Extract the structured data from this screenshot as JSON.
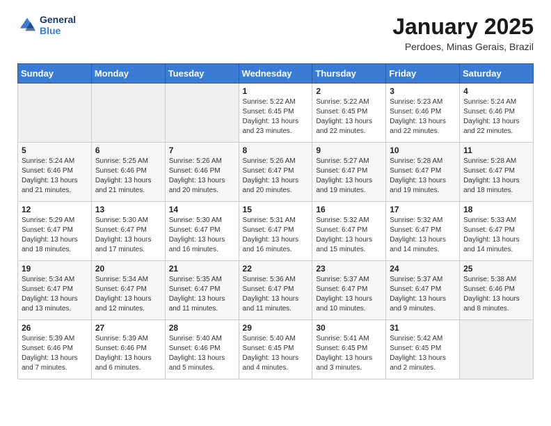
{
  "logo": {
    "line1": "General",
    "line2": "Blue"
  },
  "title": "January 2025",
  "subtitle": "Perdoes, Minas Gerais, Brazil",
  "headers": [
    "Sunday",
    "Monday",
    "Tuesday",
    "Wednesday",
    "Thursday",
    "Friday",
    "Saturday"
  ],
  "weeks": [
    [
      {
        "day": "",
        "info": ""
      },
      {
        "day": "",
        "info": ""
      },
      {
        "day": "",
        "info": ""
      },
      {
        "day": "1",
        "info": "Sunrise: 5:22 AM\nSunset: 6:45 PM\nDaylight: 13 hours\nand 23 minutes."
      },
      {
        "day": "2",
        "info": "Sunrise: 5:22 AM\nSunset: 6:45 PM\nDaylight: 13 hours\nand 22 minutes."
      },
      {
        "day": "3",
        "info": "Sunrise: 5:23 AM\nSunset: 6:46 PM\nDaylight: 13 hours\nand 22 minutes."
      },
      {
        "day": "4",
        "info": "Sunrise: 5:24 AM\nSunset: 6:46 PM\nDaylight: 13 hours\nand 22 minutes."
      }
    ],
    [
      {
        "day": "5",
        "info": "Sunrise: 5:24 AM\nSunset: 6:46 PM\nDaylight: 13 hours\nand 21 minutes."
      },
      {
        "day": "6",
        "info": "Sunrise: 5:25 AM\nSunset: 6:46 PM\nDaylight: 13 hours\nand 21 minutes."
      },
      {
        "day": "7",
        "info": "Sunrise: 5:26 AM\nSunset: 6:46 PM\nDaylight: 13 hours\nand 20 minutes."
      },
      {
        "day": "8",
        "info": "Sunrise: 5:26 AM\nSunset: 6:47 PM\nDaylight: 13 hours\nand 20 minutes."
      },
      {
        "day": "9",
        "info": "Sunrise: 5:27 AM\nSunset: 6:47 PM\nDaylight: 13 hours\nand 19 minutes."
      },
      {
        "day": "10",
        "info": "Sunrise: 5:28 AM\nSunset: 6:47 PM\nDaylight: 13 hours\nand 19 minutes."
      },
      {
        "day": "11",
        "info": "Sunrise: 5:28 AM\nSunset: 6:47 PM\nDaylight: 13 hours\nand 18 minutes."
      }
    ],
    [
      {
        "day": "12",
        "info": "Sunrise: 5:29 AM\nSunset: 6:47 PM\nDaylight: 13 hours\nand 18 minutes."
      },
      {
        "day": "13",
        "info": "Sunrise: 5:30 AM\nSunset: 6:47 PM\nDaylight: 13 hours\nand 17 minutes."
      },
      {
        "day": "14",
        "info": "Sunrise: 5:30 AM\nSunset: 6:47 PM\nDaylight: 13 hours\nand 16 minutes."
      },
      {
        "day": "15",
        "info": "Sunrise: 5:31 AM\nSunset: 6:47 PM\nDaylight: 13 hours\nand 16 minutes."
      },
      {
        "day": "16",
        "info": "Sunrise: 5:32 AM\nSunset: 6:47 PM\nDaylight: 13 hours\nand 15 minutes."
      },
      {
        "day": "17",
        "info": "Sunrise: 5:32 AM\nSunset: 6:47 PM\nDaylight: 13 hours\nand 14 minutes."
      },
      {
        "day": "18",
        "info": "Sunrise: 5:33 AM\nSunset: 6:47 PM\nDaylight: 13 hours\nand 14 minutes."
      }
    ],
    [
      {
        "day": "19",
        "info": "Sunrise: 5:34 AM\nSunset: 6:47 PM\nDaylight: 13 hours\nand 13 minutes."
      },
      {
        "day": "20",
        "info": "Sunrise: 5:34 AM\nSunset: 6:47 PM\nDaylight: 13 hours\nand 12 minutes."
      },
      {
        "day": "21",
        "info": "Sunrise: 5:35 AM\nSunset: 6:47 PM\nDaylight: 13 hours\nand 11 minutes."
      },
      {
        "day": "22",
        "info": "Sunrise: 5:36 AM\nSunset: 6:47 PM\nDaylight: 13 hours\nand 11 minutes."
      },
      {
        "day": "23",
        "info": "Sunrise: 5:37 AM\nSunset: 6:47 PM\nDaylight: 13 hours\nand 10 minutes."
      },
      {
        "day": "24",
        "info": "Sunrise: 5:37 AM\nSunset: 6:47 PM\nDaylight: 13 hours\nand 9 minutes."
      },
      {
        "day": "25",
        "info": "Sunrise: 5:38 AM\nSunset: 6:46 PM\nDaylight: 13 hours\nand 8 minutes."
      }
    ],
    [
      {
        "day": "26",
        "info": "Sunrise: 5:39 AM\nSunset: 6:46 PM\nDaylight: 13 hours\nand 7 minutes."
      },
      {
        "day": "27",
        "info": "Sunrise: 5:39 AM\nSunset: 6:46 PM\nDaylight: 13 hours\nand 6 minutes."
      },
      {
        "day": "28",
        "info": "Sunrise: 5:40 AM\nSunset: 6:46 PM\nDaylight: 13 hours\nand 5 minutes."
      },
      {
        "day": "29",
        "info": "Sunrise: 5:40 AM\nSunset: 6:45 PM\nDaylight: 13 hours\nand 4 minutes."
      },
      {
        "day": "30",
        "info": "Sunrise: 5:41 AM\nSunset: 6:45 PM\nDaylight: 13 hours\nand 3 minutes."
      },
      {
        "day": "31",
        "info": "Sunrise: 5:42 AM\nSunset: 6:45 PM\nDaylight: 13 hours\nand 2 minutes."
      },
      {
        "day": "",
        "info": ""
      }
    ]
  ]
}
